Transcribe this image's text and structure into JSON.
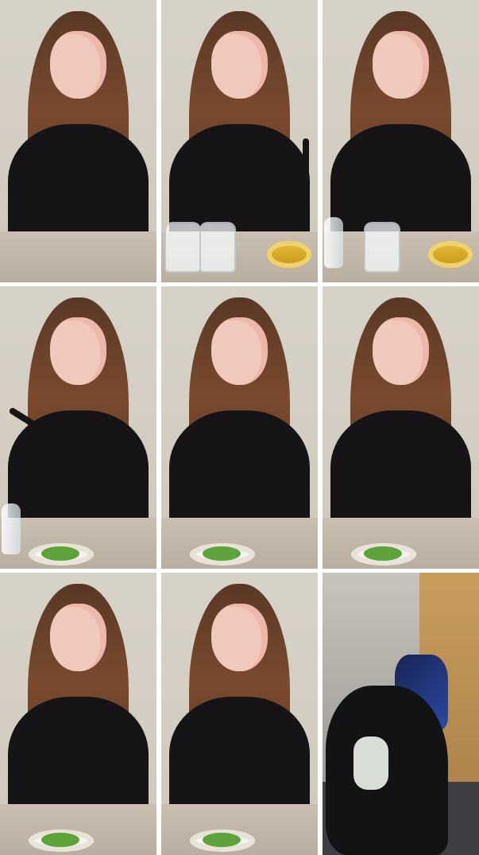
{
  "grid": {
    "tiles": [
      {
        "label": ""
      },
      {
        "label": ""
      },
      {
        "label": ""
      },
      {
        "label": ""
      },
      {
        "label": ""
      },
      {
        "label": ""
      },
      {
        "label": ""
      },
      {
        "label": ""
      },
      {
        "label": ""
      }
    ]
  }
}
